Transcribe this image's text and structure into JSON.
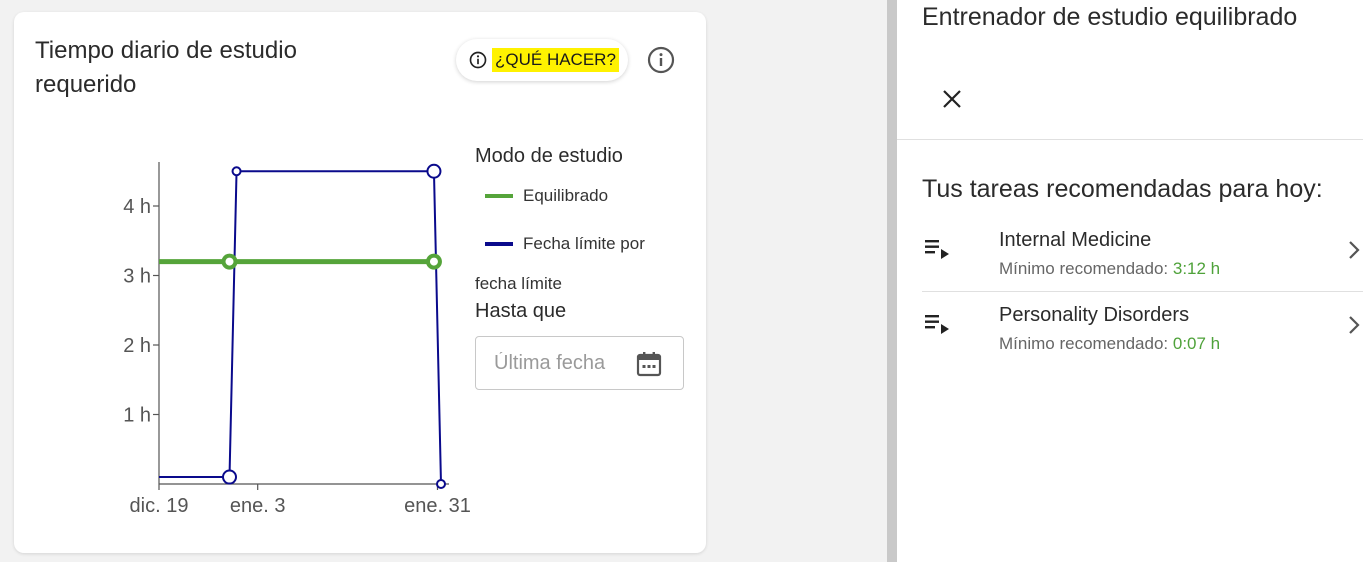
{
  "card": {
    "title": "Tiempo diario de estudio requerido",
    "help_label": "¿QUÉ HACER?",
    "help_icon": "info-circle-icon",
    "info_icon": "info-circle-icon"
  },
  "legend": {
    "title": "Modo de estudio",
    "items": [
      {
        "label": "Equilibrado",
        "color": "#55a43a"
      },
      {
        "label": "Fecha límite por",
        "color": "#0a0a8c"
      }
    ],
    "wrap_text": "fecha límite"
  },
  "until": {
    "label": "Hasta que",
    "placeholder": "Última fecha",
    "icon": "calendar-icon"
  },
  "chart_data": {
    "type": "line",
    "y_ticks": [
      "4 h",
      "3 h",
      "2 h",
      "1 h"
    ],
    "x_ticks": [
      "dic. 19",
      "ene. 3",
      "ene. 31"
    ],
    "series": [
      {
        "name": "Equilibrado",
        "color": "#55a43a",
        "points": [
          {
            "x": 0,
            "y": 3.2
          },
          {
            "x": 10,
            "y": 3.2
          },
          {
            "x": 39,
            "y": 3.2
          }
        ]
      },
      {
        "name": "Fecha límite por fecha límite",
        "color": "#0a0a8c",
        "points": [
          {
            "x": 0,
            "y": 0.1
          },
          {
            "x": 10,
            "y": 0.1
          },
          {
            "x": 11,
            "y": 4.5
          },
          {
            "x": 39,
            "y": 4.5
          },
          {
            "x": 40,
            "y": 0
          }
        ]
      }
    ]
  },
  "panel": {
    "title": "Entrenador de estudio equilibrado",
    "close_icon": "close-icon",
    "recommended_title": "Tus tareas recomendadas para hoy:",
    "tasks": [
      {
        "name": "Internal Medicine",
        "min_label": "Mínimo recomendado:",
        "min_value": "3:12 h",
        "icon": "queue-play-icon"
      },
      {
        "name": "Personality Disorders",
        "min_label": "Mínimo recomendado:",
        "min_value": "0:07 h",
        "icon": "queue-play-icon"
      }
    ],
    "accent": "#4fa23a"
  }
}
